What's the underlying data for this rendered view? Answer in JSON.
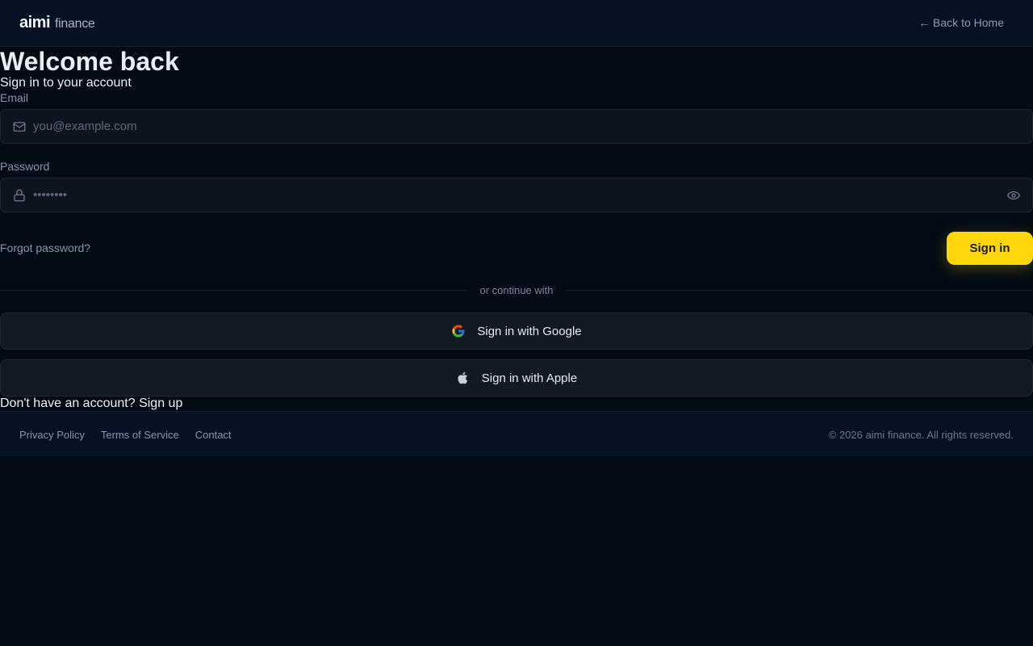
{
  "header": {
    "logo_main": "aimi",
    "logo_sub": "finance",
    "back_link": "← Back to Home"
  },
  "form": {
    "title": "Welcome back",
    "subtitle": "Sign in to your account",
    "email_label": "Email",
    "email_placeholder": "you@example.com",
    "email_value": "",
    "password_label": "Password",
    "password_placeholder": "••••••••",
    "password_value": "",
    "forgot_link": "Forgot password?",
    "submit_label": "Sign in",
    "divider_text": "or continue with",
    "google_label": "Sign in with Google",
    "apple_label": "Sign in with Apple",
    "signup_prompt": "Don't have an account?",
    "signup_link": "Sign up"
  },
  "footer": {
    "links": [
      "Privacy Policy",
      "Terms of Service",
      "Contact"
    ],
    "copyright": "© 2026 aimi finance. All rights reserved."
  },
  "icons": {
    "email": "mail-icon",
    "password": "lock-icon",
    "visibility": "eye-icon",
    "google": "google-icon",
    "apple": "apple-icon"
  },
  "colors": {
    "accent": "#ffd60a",
    "background": "#020a14",
    "header_bg": "#061223"
  }
}
